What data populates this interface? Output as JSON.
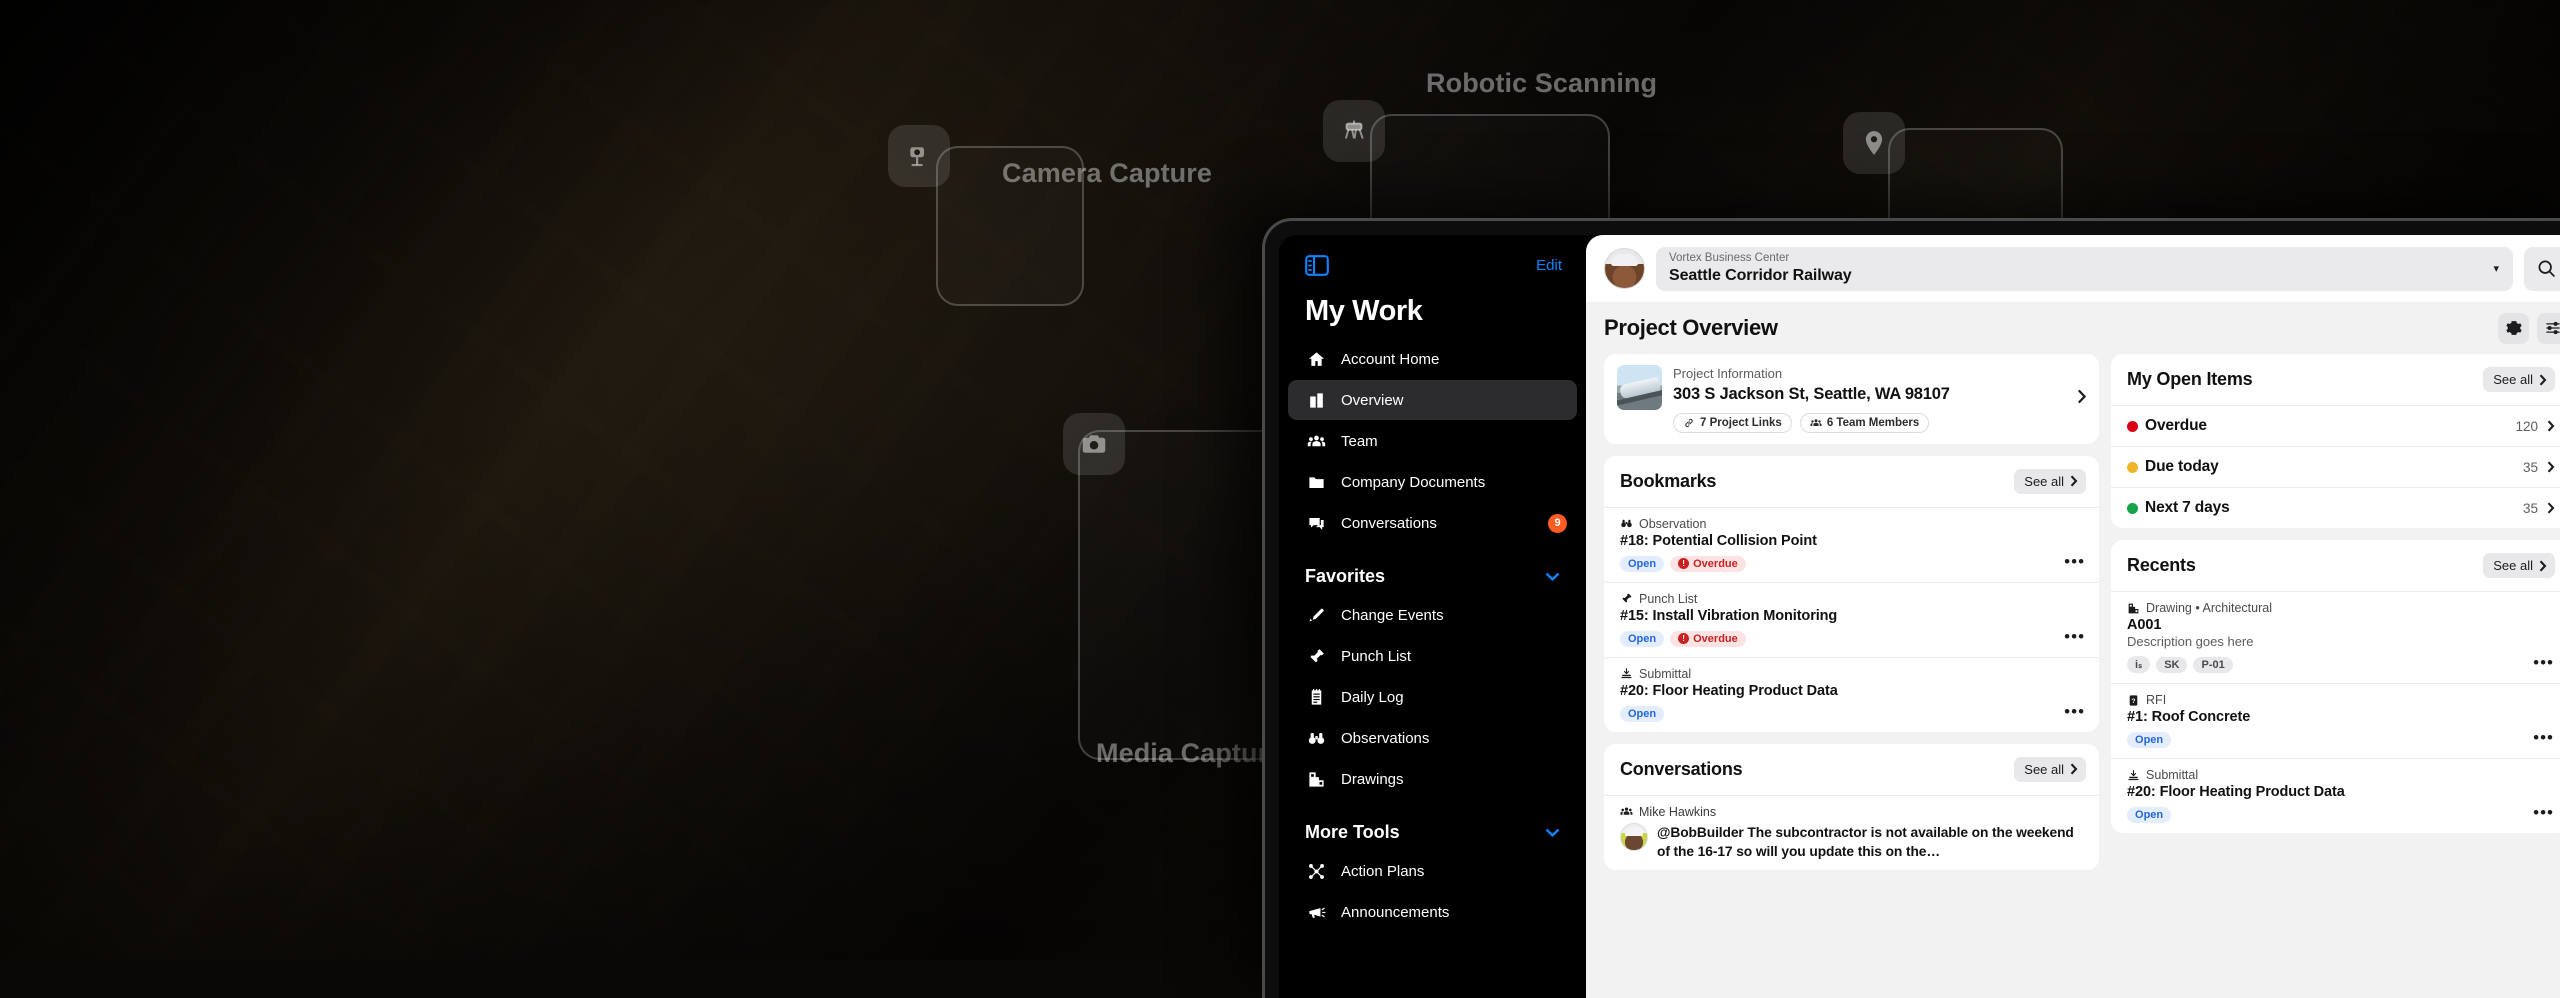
{
  "background": {
    "overlays": [
      {
        "label": "Camera Capture",
        "icon": "camera-on-tripod-icon"
      },
      {
        "label": "Robotic Scanning",
        "icon": "robot-dog-icon"
      },
      {
        "label": "Media Capture",
        "icon": "camera-icon"
      },
      {
        "label": "",
        "icon": "location-pin-icon"
      }
    ]
  },
  "sidebar": {
    "toggle_icon": "sidebar-toggle-icon",
    "edit_label": "Edit",
    "title": "My Work",
    "primary_items": [
      {
        "label": "Account Home",
        "icon": "home-icon",
        "active": false,
        "badge": ""
      },
      {
        "label": "Overview",
        "icon": "building-icon",
        "active": true,
        "badge": ""
      },
      {
        "label": "Team",
        "icon": "people-icon",
        "active": false,
        "badge": ""
      },
      {
        "label": "Company Documents",
        "icon": "folder-icon",
        "active": false,
        "badge": ""
      },
      {
        "label": "Conversations",
        "icon": "chat-icon",
        "active": false,
        "badge": "9"
      }
    ],
    "favorites_section": "Favorites",
    "favorites_items": [
      {
        "label": "Change Events",
        "icon": "pen-icon"
      },
      {
        "label": "Punch List",
        "icon": "pushpin-icon"
      },
      {
        "label": "Daily Log",
        "icon": "notepad-icon"
      },
      {
        "label": "Observations",
        "icon": "binoculars-icon"
      },
      {
        "label": "Drawings",
        "icon": "blueprint-icon"
      }
    ],
    "more_tools_section": "More Tools",
    "more_tools_items": [
      {
        "label": "Action Plans",
        "icon": "network-icon"
      },
      {
        "label": "Announcements",
        "icon": "megaphone-icon"
      }
    ]
  },
  "topbar": {
    "company": "Vortex Business Center",
    "project": "Seattle Corridor Railway",
    "caret": "▾",
    "search_icon": "search-icon"
  },
  "page": {
    "title": "Project Overview",
    "actions": [
      {
        "icon": "gear-icon",
        "name": "settings-button"
      },
      {
        "icon": "sliders-icon",
        "name": "customize-button"
      }
    ]
  },
  "project_information": {
    "label": "Project Information",
    "address": "303 S Jackson St, Seattle, WA 98107",
    "chips": [
      {
        "text": "7 Project Links",
        "icon": "link-icon"
      },
      {
        "text": "6 Team Members",
        "icon": "people-icon"
      }
    ]
  },
  "bookmarks": {
    "title": "Bookmarks",
    "see_all": "See all",
    "items": [
      {
        "kind": "Observation",
        "kind_icon": "binoculars-icon",
        "title": "#18: Potential Collision Point",
        "tags": [
          {
            "text": "Open",
            "style": "open"
          },
          {
            "text": "Overdue",
            "style": "overdue"
          }
        ]
      },
      {
        "kind": "Punch List",
        "kind_icon": "pushpin-icon",
        "title": "#15: Install Vibration Monitoring",
        "tags": [
          {
            "text": "Open",
            "style": "open"
          },
          {
            "text": "Overdue",
            "style": "overdue"
          }
        ]
      },
      {
        "kind": "Submittal",
        "kind_icon": "submittal-icon",
        "title": "#20: Floor Heating Product Data",
        "tags": [
          {
            "text": "Open",
            "style": "open"
          }
        ]
      }
    ]
  },
  "conversations": {
    "title": "Conversations",
    "see_all": "See all",
    "items": [
      {
        "author": "Mike Hawkins",
        "author_icon": "people-icon",
        "message": "@BobBuilder The subcontractor is not available on the weekend of the 16-17 so will you update this on the…"
      }
    ]
  },
  "my_open_items": {
    "title": "My Open Items",
    "see_all": "See all",
    "rows": [
      {
        "label": "Overdue",
        "count": "120",
        "color": "#d70015"
      },
      {
        "label": "Due today",
        "count": "35",
        "color": "#f0b429"
      },
      {
        "label": "Next 7 days",
        "count": "35",
        "color": "#16a34a"
      }
    ]
  },
  "recents": {
    "title": "Recents",
    "see_all": "See all",
    "items": [
      {
        "kind": "Drawing • Architectural",
        "kind_icon": "blueprint-icon",
        "title": "A001",
        "desc": "Description goes here",
        "tags": [
          {
            "text": "iₛ",
            "style": "grey"
          },
          {
            "text": "SK",
            "style": "grey"
          },
          {
            "text": "P-01",
            "style": "grey"
          }
        ]
      },
      {
        "kind": "RFI",
        "kind_icon": "rfi-icon",
        "title": "#1: Roof Concrete",
        "desc": "",
        "tags": [
          {
            "text": "Open",
            "style": "open"
          }
        ]
      },
      {
        "kind": "Submittal",
        "kind_icon": "submittal-icon",
        "title": "#20: Floor Heating Product Data",
        "desc": "",
        "tags": [
          {
            "text": "Open",
            "style": "open"
          }
        ]
      }
    ]
  },
  "colors": {
    "accent": "#0a84ff",
    "badge": "#ff5b22",
    "open_tag": "#2567d8",
    "overdue_tag": "#cc2020"
  }
}
